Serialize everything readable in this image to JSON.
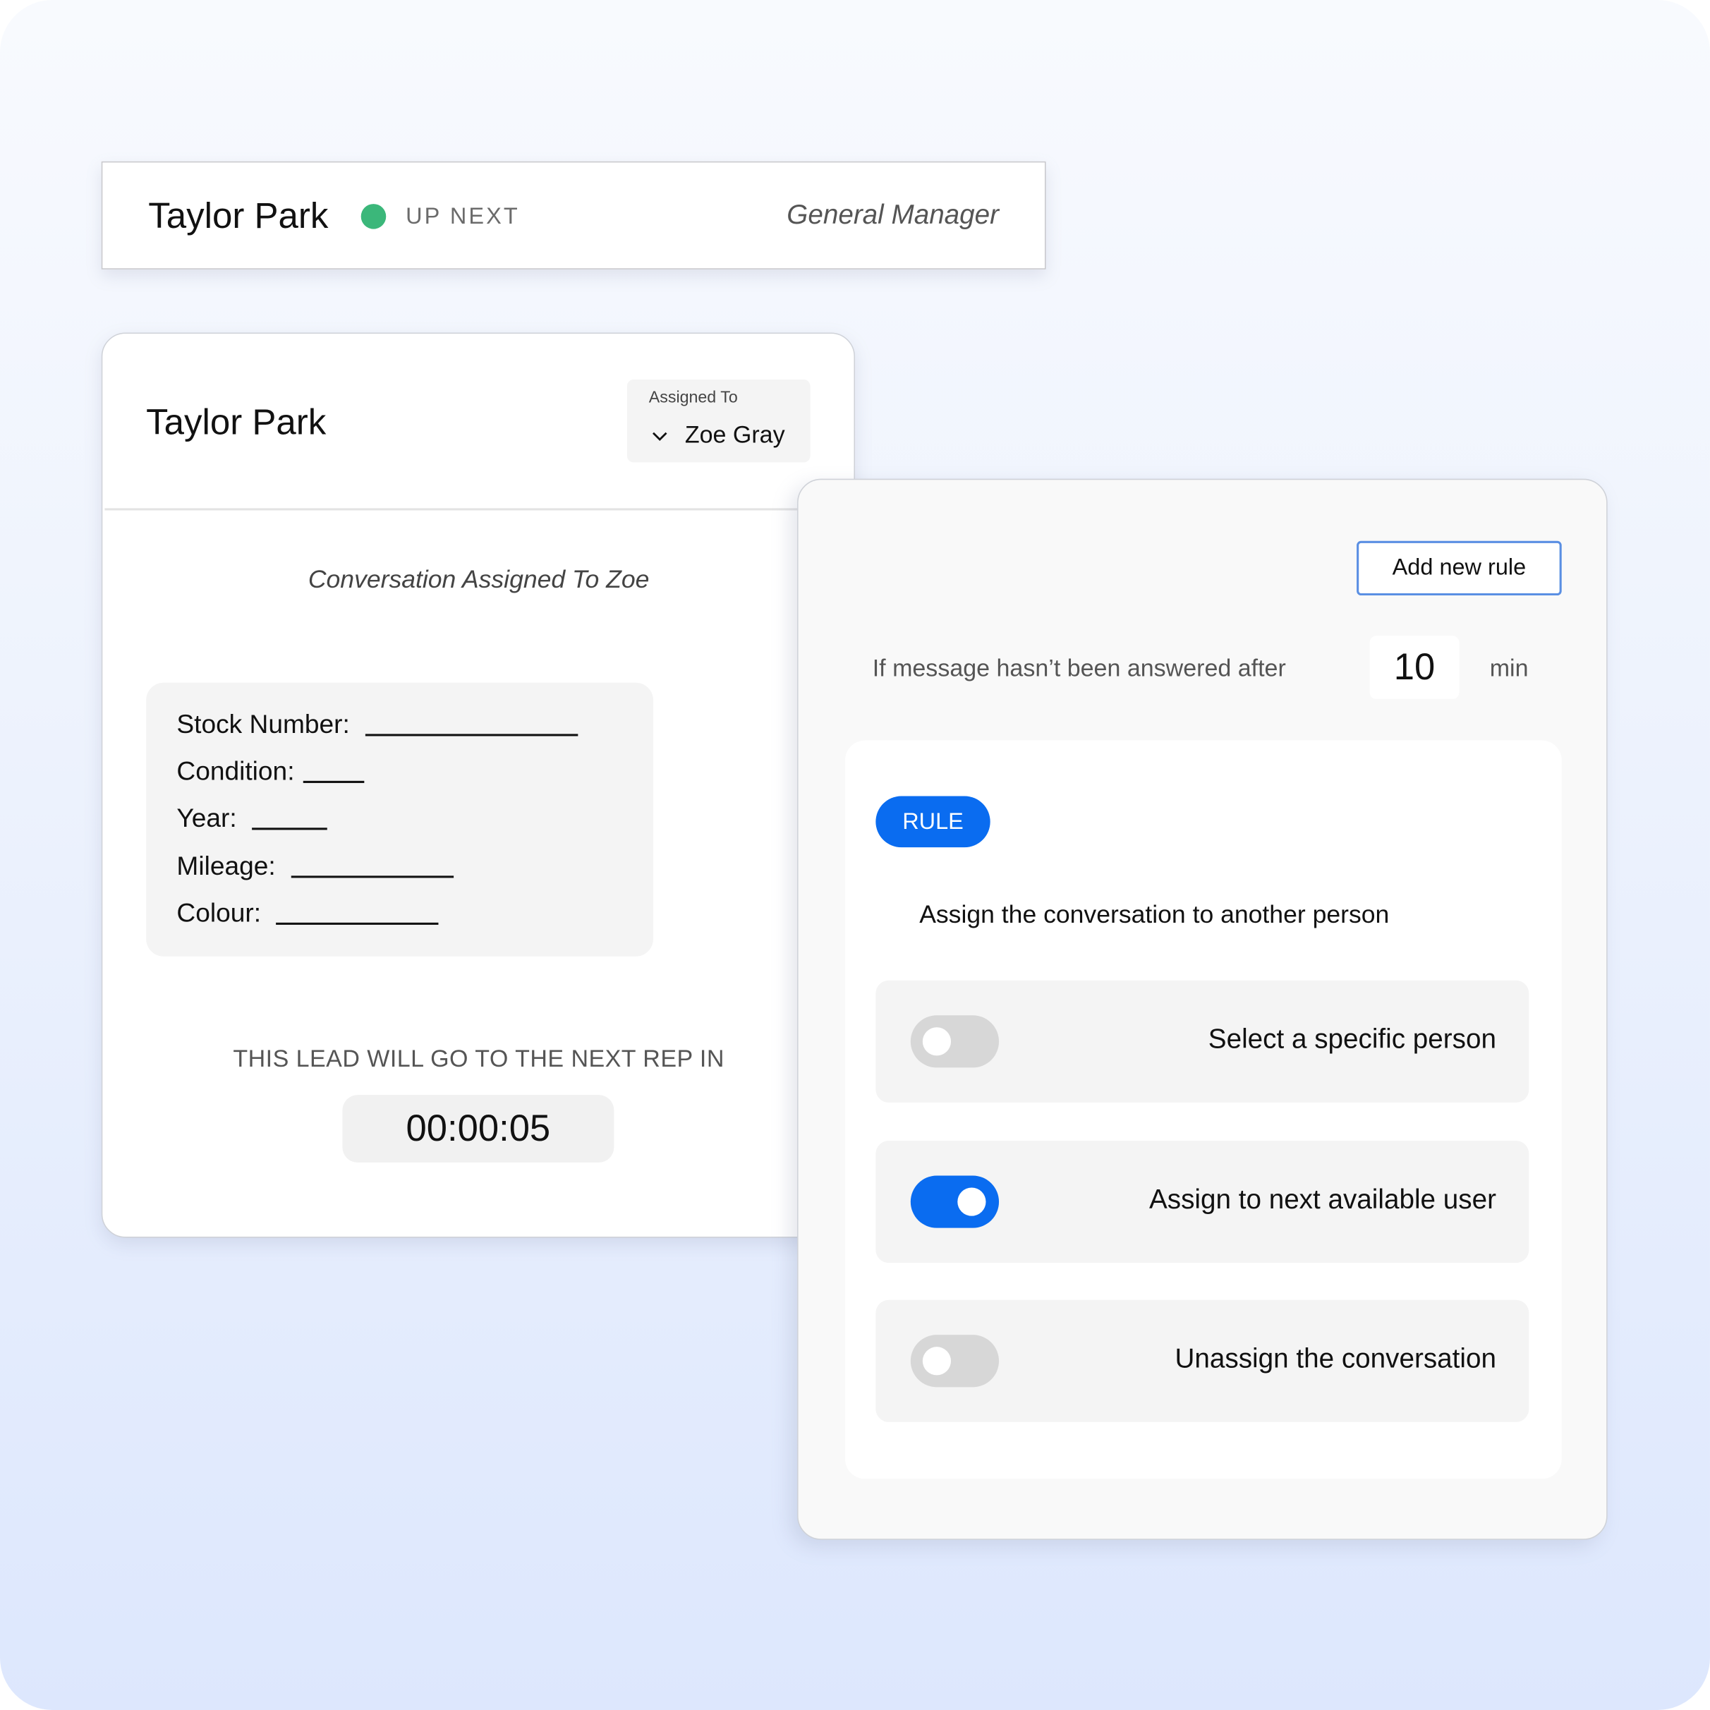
{
  "colors": {
    "accent_blue": "#0a6cf0",
    "status_green": "#3bb77a",
    "button_border": "#5a8fe3"
  },
  "queue_card": {
    "name": "Taylor Park",
    "status": "UP NEXT",
    "status_icon": "green-status-dot",
    "role": "General Manager"
  },
  "lead_card": {
    "name": "Taylor Park",
    "assigned_to_label": "Assigned To",
    "assigned_to_value": "Zoe Gray",
    "dropdown_icon": "chevron-down-icon",
    "assignment_note": "Conversation Assigned To Zoe",
    "details": [
      {
        "label": "Stock Number:",
        "value": ""
      },
      {
        "label": "Condition:",
        "value": ""
      },
      {
        "label": "Year:",
        "value": ""
      },
      {
        "label": "Mileage:",
        "value": ""
      },
      {
        "label": "Colour:",
        "value": ""
      }
    ],
    "countdown_label": "THIS LEAD WILL GO TO THE NEXT REP IN",
    "countdown_value": "00:00:05"
  },
  "rules_panel": {
    "add_rule_label": "Add new rule",
    "condition_text": "If message hasn’t been answered after",
    "minutes_value": "10",
    "minutes_unit": "min",
    "rule_badge": "RULE",
    "rule_description": "Assign the conversation to another person",
    "options": [
      {
        "label": "Select a specific person",
        "enabled": false
      },
      {
        "label": "Assign to next available user",
        "enabled": true
      },
      {
        "label": "Unassign the conversation",
        "enabled": false
      }
    ]
  }
}
